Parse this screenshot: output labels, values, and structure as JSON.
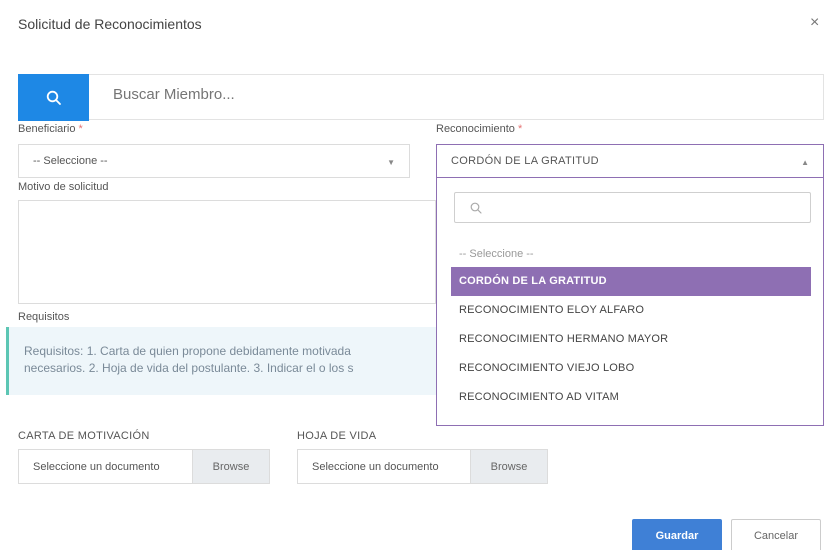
{
  "modal": {
    "title": "Solicitud de Reconocimientos",
    "close": "×"
  },
  "search": {
    "placeholder": "Buscar Miembro..."
  },
  "beneficiario": {
    "label": "Beneficiario",
    "required_mark": "*",
    "value": "-- Seleccione --"
  },
  "reconocimiento": {
    "label": "Reconocimiento",
    "required_mark": "*",
    "value": "CORDÓN DE LA GRATITUD",
    "search_placeholder": "",
    "options": [
      "-- Seleccione --",
      "CORDÓN DE LA GRATITUD",
      "RECONOCIMIENTO ELOY ALFARO",
      "RECONOCIMIENTO HERMANO MAYOR",
      "RECONOCIMIENTO VIEJO LOBO",
      "RECONOCIMIENTO AD VITAM"
    ]
  },
  "motivo": {
    "label": "Motivo de solicitud",
    "value": ""
  },
  "requisitos": {
    "label": "Requisitos",
    "line1": "Requisitos: 1. Carta de quien propone debidamente motivada",
    "line2": "necesarios. 2. Hoja de vida del postulante. 3. Indicar el o los s"
  },
  "files": {
    "carta": {
      "label": "CARTA DE MOTIVACIÓN",
      "placeholder": "Seleccione un documento",
      "browse": "Browse"
    },
    "hoja": {
      "label": "HOJA DE VIDA",
      "placeholder": "Seleccione un documento",
      "browse": "Browse"
    }
  },
  "actions": {
    "save": "Guardar",
    "cancel": "Cancelar"
  },
  "colors": {
    "primary": "#1e88e5",
    "selected": "#8e6fb3",
    "save": "#3f80d6",
    "required": "#e57373"
  }
}
